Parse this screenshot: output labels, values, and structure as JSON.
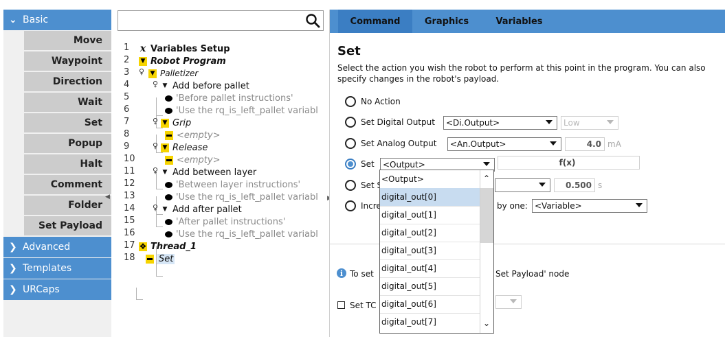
{
  "sidebar": {
    "basic_label": "Basic",
    "commands": [
      "Move",
      "Waypoint",
      "Direction",
      "Wait",
      "Set",
      "Popup",
      "Halt",
      "Comment",
      "Folder",
      "Set Payload"
    ],
    "categories": [
      "Advanced",
      "Templates",
      "URCaps"
    ]
  },
  "tree": {
    "rows": [
      {
        "n": "1",
        "label": "Variables Setup"
      },
      {
        "n": "2",
        "label": "Robot Program"
      },
      {
        "n": "3",
        "label": "Palletizer"
      },
      {
        "n": "4",
        "label": "Add before pallet"
      },
      {
        "n": "5",
        "label": "'Before pallet instructions'"
      },
      {
        "n": "6",
        "label": "'Use the rq_is_left_pallet variabl"
      },
      {
        "n": "7",
        "label": "Grip"
      },
      {
        "n": "8",
        "label": "<empty>"
      },
      {
        "n": "9",
        "label": "Release"
      },
      {
        "n": "10",
        "label": "<empty>"
      },
      {
        "n": "11",
        "label": "Add between layer"
      },
      {
        "n": "12",
        "label": "'Between layer instructions'"
      },
      {
        "n": "13",
        "label": "'Use the rq_is_left_pallet variabl"
      },
      {
        "n": "14",
        "label": "Add after pallet"
      },
      {
        "n": "15",
        "label": "'After pallet instructions'"
      },
      {
        "n": "16",
        "label": "'Use the rq_is_left_pallet variabl"
      },
      {
        "n": "17",
        "label": "Thread_1"
      },
      {
        "n": "18",
        "label": "Set"
      }
    ]
  },
  "tabs": [
    "Command",
    "Graphics",
    "Variables"
  ],
  "set": {
    "title": "Set",
    "description": "Select the action you wish the robot to perform at this point in the program. You can also specify changes in the robot's payload.",
    "no_action": "No Action",
    "digital_label": "Set Digital Output",
    "digital_select": "<Di.Output>",
    "digital_value": "Low",
    "analog_label": "Set Analog Output",
    "analog_select": "<An.Output>",
    "analog_value": "4.0",
    "analog_unit": "mA",
    "set_label": "Set",
    "set_select": "<Output>",
    "fx": "f(x)",
    "set4_label": "Set S",
    "set4_value": "0.500",
    "set4_unit": "s",
    "incr_label": "Incre",
    "by_one": "by one:",
    "variable_select": "<Variable>",
    "info_prefix": "To set",
    "info_suffix": "Set Payload' node",
    "tcp_label": "Set TC"
  },
  "dropdown": {
    "options": [
      "<Output>",
      "digital_out[0]",
      "digital_out[1]",
      "digital_out[2]",
      "digital_out[3]",
      "digital_out[4]",
      "digital_out[5]",
      "digital_out[6]",
      "digital_out[7]"
    ],
    "highlighted_index": 1
  },
  "colors": {
    "accent": "#4d8fcf",
    "active_tab": "#3b7ec3",
    "command_bg": "#cccccc",
    "program_icon": "#f6d400"
  }
}
